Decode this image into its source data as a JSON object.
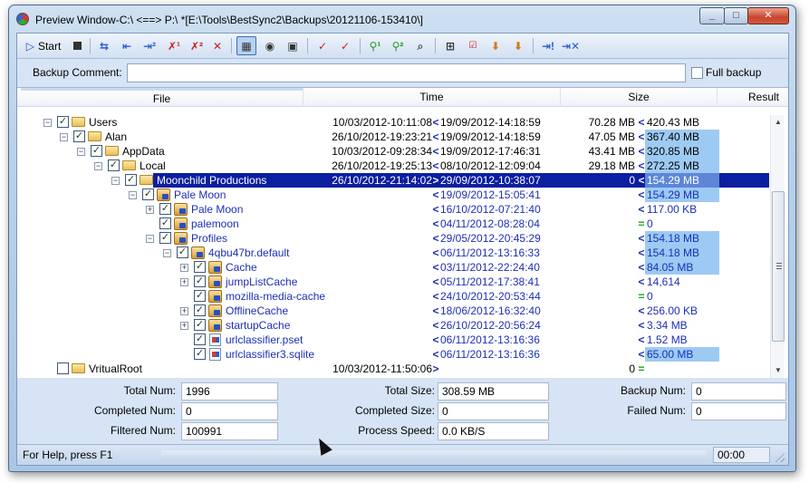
{
  "window": {
    "title": "Preview Window-C:\\ <==> P:\\ *[E:\\Tools\\BestSync2\\Backups\\20121106-153410\\]"
  },
  "toolbar": {
    "start_label": "Start",
    "icons": [
      "play-icon",
      "stop-icon",
      "sync-arrows-icon",
      "copy-left-icon",
      "copy-right-icon",
      "delete-1-icon",
      "delete-2-icon",
      "delete-icon",
      "view-toggle-icon",
      "eye-icon",
      "filter-view-icon",
      "check-red-icon",
      "check-red-2-icon",
      "search-1-icon",
      "search-2-icon",
      "find-icon",
      "tree-icon",
      "all-icon",
      "down-arrow-icon",
      "down-arrow-2-icon",
      "flag-icon",
      "clear-icon"
    ]
  },
  "comment": {
    "label": "Backup Comment:",
    "value": "",
    "full_backup_label": "Full backup",
    "full_backup_checked": false
  },
  "grid": {
    "headers": {
      "file": "File",
      "time": "Time",
      "size": "Size",
      "result": "Result"
    },
    "rows": [
      {
        "name": "Users",
        "t1": "10/03/2012-10:11:08",
        "dir": "<",
        "t2": "19/09/2012-14:18:59",
        "s1": "70.28 MB",
        "sdir": "<",
        "s2": "420.43 MB",
        "blue": false
      },
      {
        "name": "Alan",
        "t1": "26/10/2012-19:23:21",
        "dir": "<",
        "t2": "19/09/2012-14:18:59",
        "s1": "47.05 MB",
        "sdir": "<",
        "s2": "367.40 MB",
        "blue": false
      },
      {
        "name": "AppData",
        "t1": "10/03/2012-09:28:34",
        "dir": "<",
        "t2": "19/09/2012-17:46:31",
        "s1": "43.41 MB",
        "sdir": "<",
        "s2": "320.85 MB",
        "blue": false
      },
      {
        "name": "Local",
        "t1": "26/10/2012-19:25:13",
        "dir": "<",
        "t2": "08/10/2012-12:09:04",
        "s1": "29.18 MB",
        "sdir": "<",
        "s2": "272.25 MB",
        "blue": false
      },
      {
        "name": "Moonchild Productions",
        "t1": "26/10/2012-21:14:02",
        "dir": ">",
        "t2": "29/09/2012-10:38:07",
        "s1": "0",
        "sdir": "<",
        "s2": "154.29 MB",
        "blue": false
      },
      {
        "name": "Pale Moon",
        "t1": "",
        "dir": "<",
        "t2": "19/09/2012-15:05:41",
        "s1": "",
        "sdir": "<",
        "s2": "154.29 MB",
        "blue": true
      },
      {
        "name": "Pale Moon",
        "t1": "",
        "dir": "<",
        "t2": "16/10/2012-07:21:40",
        "s1": "",
        "sdir": "<",
        "s2": "117.00 KB",
        "blue": true
      },
      {
        "name": "palemoon",
        "t1": "",
        "dir": "<",
        "t2": "04/11/2012-08:28:04",
        "s1": "",
        "sdir": "=",
        "s2": "0",
        "blue": true
      },
      {
        "name": "Profiles",
        "t1": "",
        "dir": "<",
        "t2": "29/05/2012-20:45:29",
        "s1": "",
        "sdir": "<",
        "s2": "154.18 MB",
        "blue": true
      },
      {
        "name": "4qbu47br.default",
        "t1": "",
        "dir": "<",
        "t2": "06/11/2012-13:16:33",
        "s1": "",
        "sdir": "<",
        "s2": "154.18 MB",
        "blue": true
      },
      {
        "name": "Cache",
        "t1": "",
        "dir": "<",
        "t2": "03/11/2012-22:24:40",
        "s1": "",
        "sdir": "<",
        "s2": "84.05 MB",
        "blue": true
      },
      {
        "name": "jumpListCache",
        "t1": "",
        "dir": "<",
        "t2": "05/11/2012-17:38:41",
        "s1": "",
        "sdir": "<",
        "s2": "14,614",
        "blue": true
      },
      {
        "name": "mozilla-media-cache",
        "t1": "",
        "dir": "<",
        "t2": "24/10/2012-20:53:44",
        "s1": "",
        "sdir": "=",
        "s2": "0",
        "blue": true
      },
      {
        "name": "OfflineCache",
        "t1": "",
        "dir": "<",
        "t2": "18/06/2012-16:32:40",
        "s1": "",
        "sdir": "<",
        "s2": "256.00 KB",
        "blue": true
      },
      {
        "name": "startupCache",
        "t1": "",
        "dir": "<",
        "t2": "26/10/2012-20:56:24",
        "s1": "",
        "sdir": "<",
        "s2": "3.34 MB",
        "blue": true
      },
      {
        "name": "urlclassifier.pset",
        "t1": "",
        "dir": "<",
        "t2": "06/11/2012-13:16:36",
        "s1": "",
        "sdir": "<",
        "s2": "1.52 MB",
        "blue": true
      },
      {
        "name": "urlclassifier3.sqlite",
        "t1": "",
        "dir": "<",
        "t2": "06/11/2012-13:16:36",
        "s1": "",
        "sdir": "<",
        "s2": "65.00 MB",
        "blue": true
      },
      {
        "name": "VritualRoot",
        "t1": "10/03/2012-11:50:06",
        "dir": ">",
        "t2": "",
        "s1": "0",
        "sdir": "=",
        "s2": "",
        "blue": false
      }
    ]
  },
  "stats": {
    "total_num_label": "Total Num:",
    "total_num": "1996",
    "completed_num_label": "Completed Num:",
    "completed_num": "0",
    "filtered_num_label": "Filtered Num:",
    "filtered_num": "100991",
    "total_size_label": "Total Size:",
    "total_size": "308.59 MB",
    "completed_size_label": "Completed Size:",
    "completed_size": "0",
    "process_speed_label": "Process Speed:",
    "process_speed": "0.0 KB/S",
    "backup_num_label": "Backup Num:",
    "backup_num": "0",
    "failed_num_label": "Failed Num:",
    "failed_num": "0"
  },
  "status": {
    "help_text": "For Help, press F1",
    "elapsed": "00:00"
  },
  "colors": {
    "selection": "#0b1fa0",
    "size_highlight": "#9dcaf3",
    "link_blue": "#1b2fb7",
    "equal_green": "#19a819"
  }
}
